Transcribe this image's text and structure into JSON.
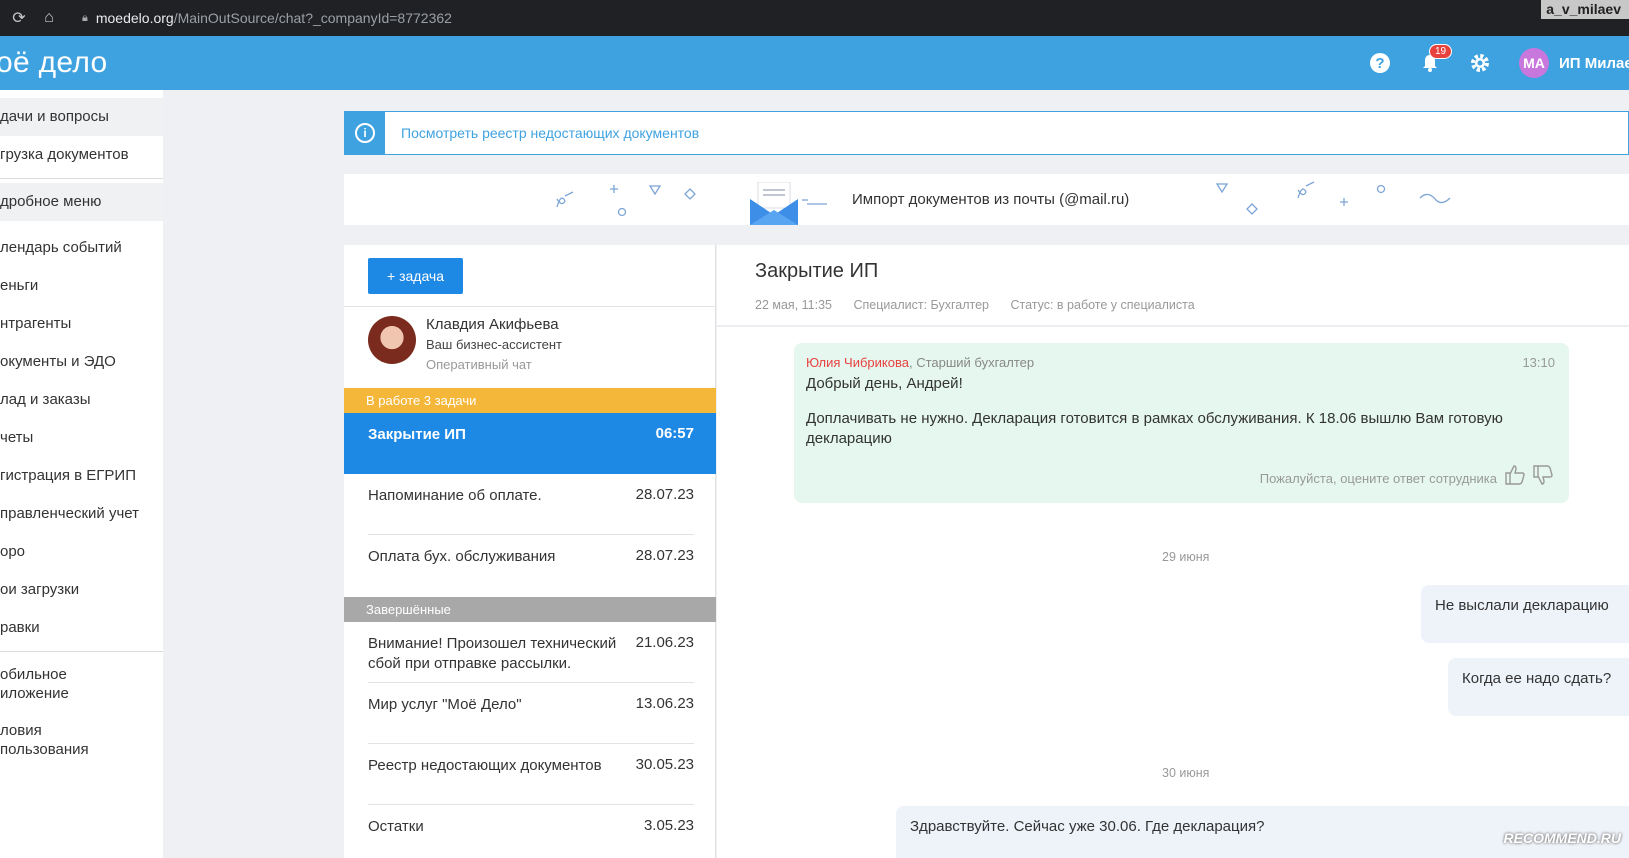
{
  "browser": {
    "url_domain": "moedelo.org",
    "url_path": "/MainOutSource/chat?_companyId=8772362",
    "user_tag": "a_v_milaev"
  },
  "header": {
    "logo": "оё дело",
    "notifications_count": "19",
    "avatar_initials": "МА",
    "user_name": "ИП Милаев"
  },
  "sidebar": {
    "items": [
      {
        "label": "дачи и вопросы"
      },
      {
        "label": "грузка документов"
      },
      {
        "label": "дробное меню"
      },
      {
        "label": "лендарь событий"
      },
      {
        "label": "еньги"
      },
      {
        "label": "нтрагенты"
      },
      {
        "label": "окументы и ЭДО"
      },
      {
        "label": "лад и заказы"
      },
      {
        "label": "четы"
      },
      {
        "label": "гистрация в ЕГРИП"
      },
      {
        "label": "правленческий учет"
      },
      {
        "label": "оро"
      },
      {
        "label": "ои загрузки"
      },
      {
        "label": "равки"
      },
      {
        "label": "обильное\nиложение"
      },
      {
        "label": "ловия\nпользования"
      }
    ]
  },
  "banner": {
    "link": "Посмотреть реестр недостающих документов"
  },
  "import_strip": {
    "text": "Импорт документов из почты (@mail.ru)"
  },
  "tasks": {
    "add_label": "+ задача",
    "assistant": {
      "name": "Клавдия Акифьева",
      "role": "Ваш бизнес-ассистент",
      "chat": "Оперативный чат"
    },
    "in_work_header": "В работе 3 задачи",
    "in_work": [
      {
        "title": "Закрытие ИП",
        "date": "06:57"
      },
      {
        "title": "Напоминание об оплате.",
        "date": "28.07.23"
      },
      {
        "title": "Оплата бух. обслуживания",
        "date": "28.07.23"
      }
    ],
    "done_header": "Завершённые",
    "done": [
      {
        "title": "Внимание! Произошел технический сбой при отправке рассылки.",
        "date": "21.06.23"
      },
      {
        "title": "Мир услуг \"Моё Дело\"",
        "date": "13.06.23"
      },
      {
        "title": "Реестр недостающих документов",
        "date": "30.05.23"
      },
      {
        "title": "Остатки",
        "date": "3.05.23"
      }
    ]
  },
  "chat": {
    "title": "Закрытие ИП",
    "meta_date": "22 мая, 11:35",
    "meta_specialist": "Специалист: Бухгалтер",
    "meta_status": "Статус: в работе у специалиста",
    "message1": {
      "author_name": "Юлия Чибрикова",
      "author_role": ", Старший бухгалтер",
      "time": "13:10",
      "greeting": "Добрый день, Андрей!",
      "body": "Доплачивать не нужно. Декларация готовится в рамках обслуживания. К 18.06 вышлю Вам готовую декларацию",
      "rate_prompt": "Пожалуйста, оцените ответ сотрудника"
    },
    "date_sep1": "29 июня",
    "user_msg1": "Не выслали декларацию",
    "user_msg2": "Когда ее надо сдать?",
    "date_sep2": "30 июня",
    "user_msg3": "Здравствуйте. Сейчас уже 30.06. Где декларация?"
  },
  "watermark": "RECOMMEND.RU",
  "colors": {
    "brand_blue": "#3fa2e0",
    "task_active": "#1e88e5",
    "in_work_header": "#f4b73a",
    "done_header": "#a8a8a8",
    "accountant_msg_bg": "#e5f7ee"
  }
}
